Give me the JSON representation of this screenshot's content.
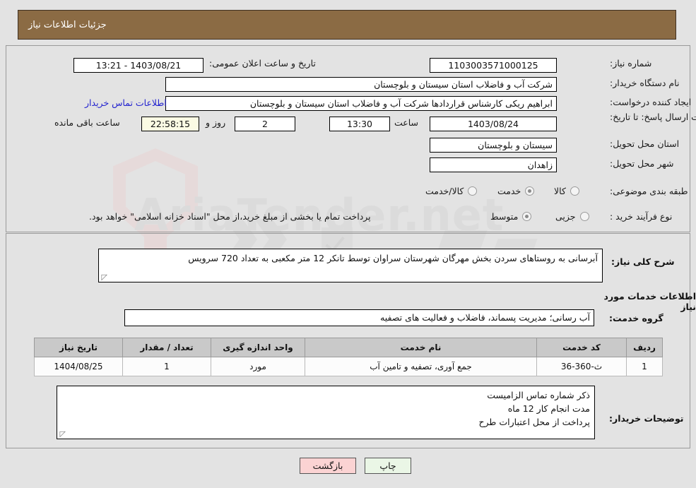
{
  "header": {
    "title": "جزئیات اطلاعات نیاز"
  },
  "form": {
    "need_number_label": "شماره نیاز:",
    "need_number_value": "1103003571000125",
    "announce_datetime_label": "تاریخ و ساعت اعلان عمومی:",
    "announce_datetime_value": "1403/08/21 - 13:21",
    "buyer_org_label": "نام دستگاه خریدار:",
    "buyer_org_value": "شرکت آب و فاضلاب استان سیستان و بلوچستان",
    "requester_label": "ایجاد کننده درخواست:",
    "requester_value": "ابراهیم ریکی کارشناس قراردادها شرکت آب و فاضلاب استان سیستان و بلوچستان",
    "contact_link": "اطلاعات تماس خریدار",
    "deadline_label": "مهلت ارسال پاسخ: تا تاریخ:",
    "deadline_date": "1403/08/24",
    "hour_label": "ساعت",
    "deadline_time": "13:30",
    "days_value": "2",
    "days_label": "روز و",
    "countdown_value": "22:58:15",
    "countdown_label": "ساعت باقی مانده",
    "province_label": "استان محل تحویل:",
    "province_value": "سیستان و بلوچستان",
    "city_label": "شهر محل تحویل:",
    "city_value": "زاهدان",
    "category_label": "طبقه بندی موضوعی:",
    "category_options": [
      "کالا",
      "خدمت",
      "کالا/خدمت"
    ],
    "category_selected": "خدمت",
    "process_label": "نوع فرآیند خرید :",
    "process_options": [
      "جزیی",
      "متوسط"
    ],
    "process_selected": "متوسط",
    "payment_note": "پرداخت تمام یا بخشی از مبلغ خرید،از محل \"اسناد خزانه اسلامی\" خواهد بود."
  },
  "description": {
    "label": "شرح کلی نیاز:",
    "value": "آبرسانی به روستاهای سردن بخش مهرگان شهرستان سراوان توسط تانکر 12 متر مکعبی به تعداد 720 سرویس"
  },
  "services": {
    "section_title": "اطلاعات خدمات مورد نیاز",
    "group_label": "گروه خدمت:",
    "group_value": "آب رسانی؛ مدیریت پسماند، فاضلاب و فعالیت های تصفیه",
    "columns": [
      "ردیف",
      "کد خدمت",
      "نام خدمت",
      "واحد اندازه گیری",
      "تعداد / مقدار",
      "تاریخ نیاز"
    ],
    "rows": [
      {
        "radif": "1",
        "code": "ث-360-36",
        "name": "جمع آوری، تصفیه و تامین آب",
        "unit": "مورد",
        "qty": "1",
        "date": "1404/08/25"
      }
    ]
  },
  "buyer_notes": {
    "label": "توضیحات خریدار:",
    "lines": [
      "ذکر شماره تماس الزامیست",
      "مدت انجام کار 12 ماه",
      "پرداخت از محل اعتبارات طرح"
    ]
  },
  "footer": {
    "back_label": "بازگشت",
    "print_label": "چاپ"
  },
  "watermark": {
    "text": "AriaTender.net"
  }
}
